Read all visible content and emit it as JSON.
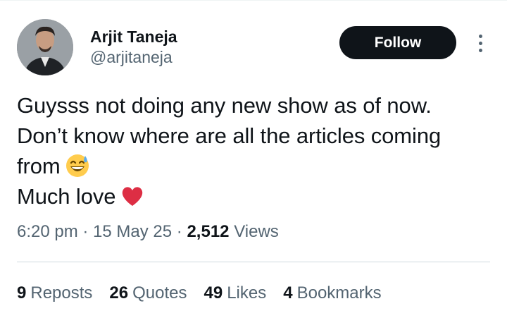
{
  "author": {
    "display_name": "Arjit Taneja",
    "handle": "@arjitaneja"
  },
  "follow_label": "Follow",
  "more_icon": "more-vertical-icon",
  "tweet": {
    "line1": "Guysss not doing any new show as of now.",
    "line2": "Don’t know where are all the articles coming",
    "line3": "from",
    "line3_emoji": "grinning-face-with-sweat-emoji",
    "line4": "Much love",
    "line4_emoji": "red-heart-emoji"
  },
  "meta": {
    "time": "6:20 pm",
    "sep1": " · ",
    "date": "15 May 25",
    "sep2": " · ",
    "views_count": "2,512",
    "views_label": "Views"
  },
  "stats": {
    "reposts_count": "9",
    "reposts_label": "Reposts",
    "quotes_count": "26",
    "quotes_label": "Quotes",
    "likes_count": "49",
    "likes_label": "Likes",
    "bookmarks_count": "4",
    "bookmarks_label": "Bookmarks"
  },
  "colors": {
    "text_primary": "#0f1419",
    "text_secondary": "#536471",
    "button_bg": "#0f1419",
    "divider": "#cfd9de"
  }
}
